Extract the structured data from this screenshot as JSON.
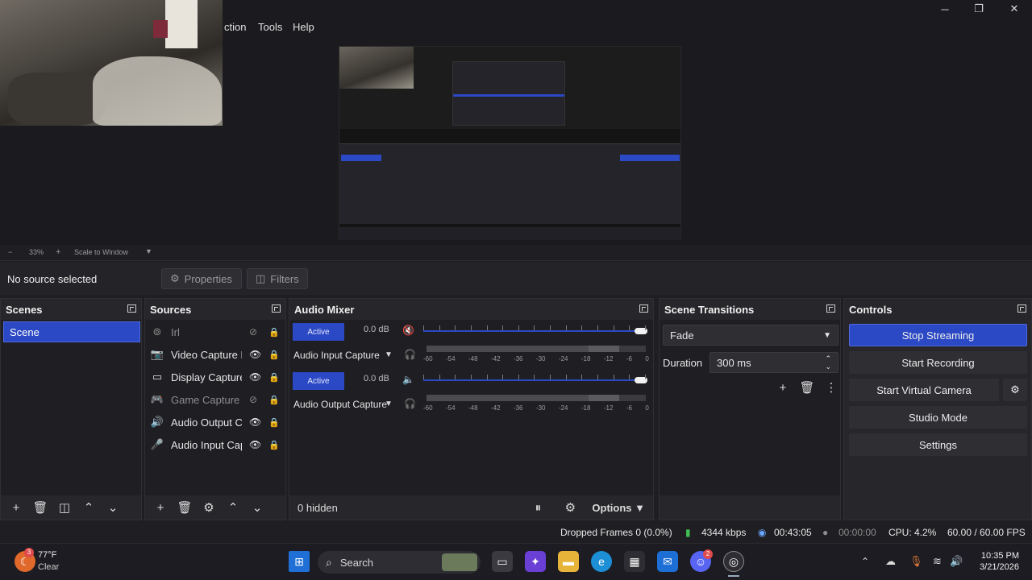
{
  "window": {
    "minimize": "─",
    "maximize": "❐",
    "close": "✕"
  },
  "menu": {
    "items": [
      "ction",
      "Tools",
      "Help"
    ]
  },
  "preview": {
    "zoom": "33%",
    "zoom_minus": "−",
    "zoom_plus": "+",
    "scale_mode": "Scale to Window"
  },
  "context": {
    "no_source": "No source selected",
    "properties": "Properties",
    "filters": "Filters"
  },
  "scenes": {
    "title": "Scenes",
    "items": [
      "Scene"
    ]
  },
  "sources": {
    "title": "Sources",
    "items": [
      {
        "label": "Irl",
        "icon": "⊚",
        "visible": false
      },
      {
        "label": "Video Capture D",
        "icon": "📷",
        "visible": true
      },
      {
        "label": "Display Capture",
        "icon": "▭",
        "visible": true
      },
      {
        "label": "Game Capture",
        "icon": "🎮",
        "visible": false
      },
      {
        "label": "Audio Output C",
        "icon": "🔊",
        "visible": true
      },
      {
        "label": "Audio Input Cap",
        "icon": "🎤",
        "visible": true
      }
    ]
  },
  "audio_mixer": {
    "title": "Audio Mixer",
    "hidden": "0 hidden",
    "options": "Options",
    "channels": [
      {
        "status": "Active",
        "db": "0.0 dB",
        "name": "Audio Input Capture",
        "muted": true
      },
      {
        "status": "Active",
        "db": "0.0 dB",
        "name": "Audio Output Capture",
        "muted": false
      }
    ],
    "scale": [
      "-60",
      "-54",
      "-48",
      "-42",
      "-36",
      "-30",
      "-24",
      "-18",
      "-12",
      "-6",
      "0"
    ]
  },
  "transitions": {
    "title": "Scene Transitions",
    "selected": "Fade",
    "duration_label": "Duration",
    "duration_value": "300 ms"
  },
  "controls": {
    "title": "Controls",
    "stop_streaming": "Stop Streaming",
    "start_recording": "Start Recording",
    "start_virtual_camera": "Start Virtual Camera",
    "studio_mode": "Studio Mode",
    "settings": "Settings"
  },
  "status": {
    "dropped_frames": "Dropped Frames 0 (0.0%)",
    "bitrate": "4344 kbps",
    "stream_time": "00:43:05",
    "record_time": "00:00:00",
    "cpu": "CPU: 4.2%",
    "fps": "60.00 / 60.00 FPS"
  },
  "taskbar": {
    "weather_temp": "77°F",
    "weather_desc": "Clear",
    "weather_badge": "3",
    "search": "Search",
    "time": "10:35 PM",
    "date": "3/21/2026",
    "discord_badge": "2"
  },
  "colors": {
    "accent": "#2b49c4",
    "muted": "#e04a4a",
    "bitrate_ok": "#3fbf4f"
  }
}
